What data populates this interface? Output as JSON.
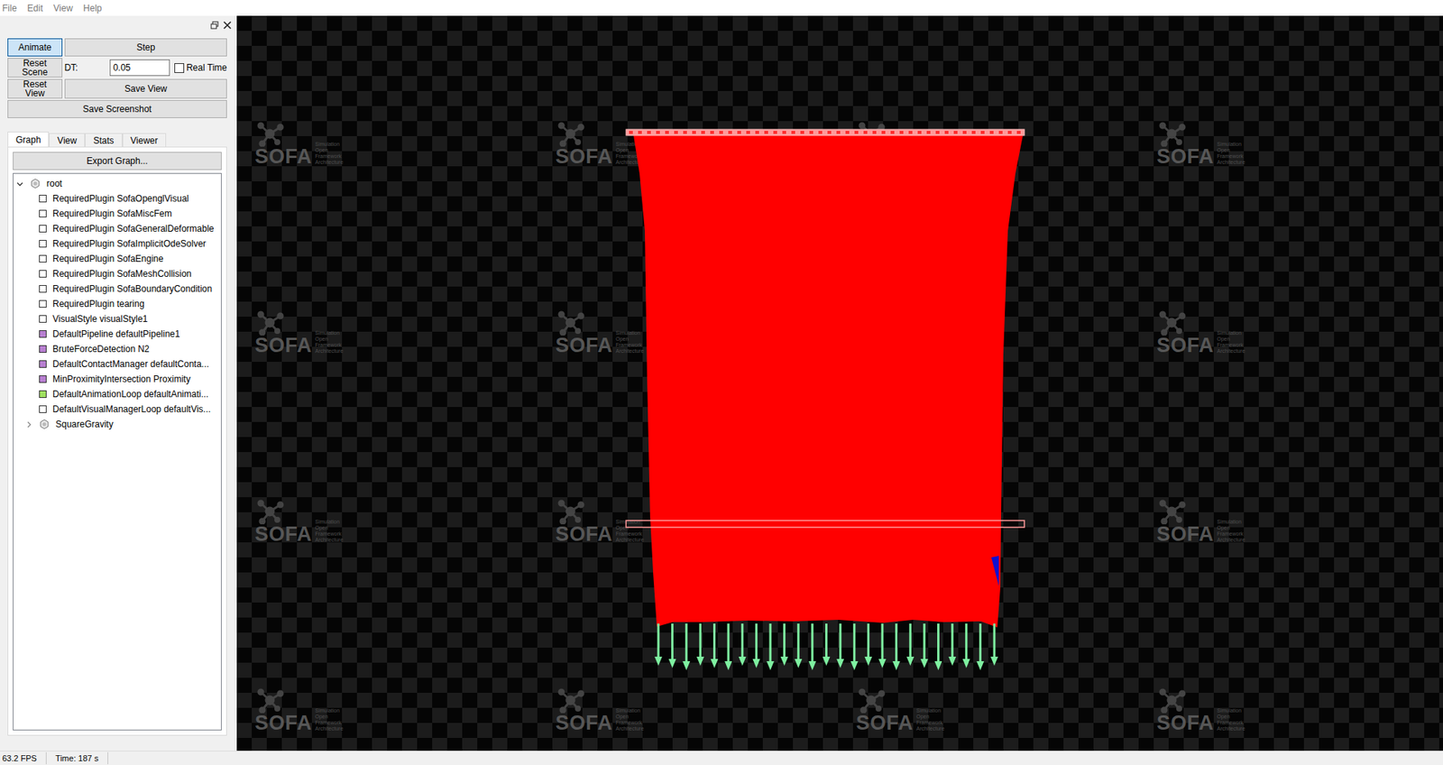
{
  "menu": [
    "File",
    "Edit",
    "View",
    "Help"
  ],
  "controls": {
    "animate": {
      "label": "Animate",
      "selected": true
    },
    "step": "Step",
    "reset_scene": "Reset Scene",
    "dt_label": "DT:",
    "dt_value": "0.05",
    "real_time": {
      "label": "Real Time",
      "checked": false
    },
    "reset_view": "Reset View",
    "save_view": "Save View",
    "save_screenshot": "Save Screenshot"
  },
  "tabs": [
    {
      "label": "Graph",
      "selected": true
    },
    {
      "label": "View",
      "selected": false
    },
    {
      "label": "Stats",
      "selected": false
    },
    {
      "label": "Viewer",
      "selected": false
    }
  ],
  "export_button": "Export Graph...",
  "tree": [
    {
      "label": "root",
      "kind": "node",
      "expanded": true,
      "level": 0
    },
    {
      "label": "RequiredPlugin SofaOpenglVisual",
      "kind": "object",
      "color": "#ffffff",
      "level": 1
    },
    {
      "label": "RequiredPlugin SofaMiscFem",
      "kind": "object",
      "color": "#ffffff",
      "level": 1
    },
    {
      "label": "RequiredPlugin SofaGeneralDeformable",
      "kind": "object",
      "color": "#ffffff",
      "level": 1
    },
    {
      "label": "RequiredPlugin SofaImplicitOdeSolver",
      "kind": "object",
      "color": "#ffffff",
      "level": 1
    },
    {
      "label": "RequiredPlugin SofaEngine",
      "kind": "object",
      "color": "#ffffff",
      "level": 1
    },
    {
      "label": "RequiredPlugin SofaMeshCollision",
      "kind": "object",
      "color": "#ffffff",
      "level": 1
    },
    {
      "label": "RequiredPlugin SofaBoundaryCondition",
      "kind": "object",
      "color": "#ffffff",
      "level": 1
    },
    {
      "label": "RequiredPlugin tearing",
      "kind": "object",
      "color": "#ffffff",
      "level": 1
    },
    {
      "label": "VisualStyle visualStyle1",
      "kind": "object",
      "color": "#ffffff",
      "level": 1
    },
    {
      "label": "DefaultPipeline defaultPipeline1",
      "kind": "object",
      "color": "#b77fd0",
      "level": 1
    },
    {
      "label": "BruteForceDetection N2",
      "kind": "object",
      "color": "#b77fd0",
      "level": 1
    },
    {
      "label": "DefaultContactManager defaultConta...",
      "kind": "object",
      "color": "#b77fd0",
      "level": 1
    },
    {
      "label": "MinProximityIntersection Proximity",
      "kind": "object",
      "color": "#b77fd0",
      "level": 1
    },
    {
      "label": "DefaultAnimationLoop defaultAnimati...",
      "kind": "object",
      "color": "#9fe060",
      "level": 1
    },
    {
      "label": "DefaultVisualManagerLoop defaultVis...",
      "kind": "object",
      "color": "#ffffff",
      "level": 1
    },
    {
      "label": "SquareGravity",
      "kind": "node",
      "expanded": false,
      "level": 1
    }
  ],
  "watermark": {
    "title": "SOFA",
    "subtitle": [
      "Simulation",
      "Open",
      "Framework",
      "Architecture"
    ]
  },
  "status_bar": {
    "fps": "63.2 FPS",
    "time": "Time: 187 s"
  }
}
